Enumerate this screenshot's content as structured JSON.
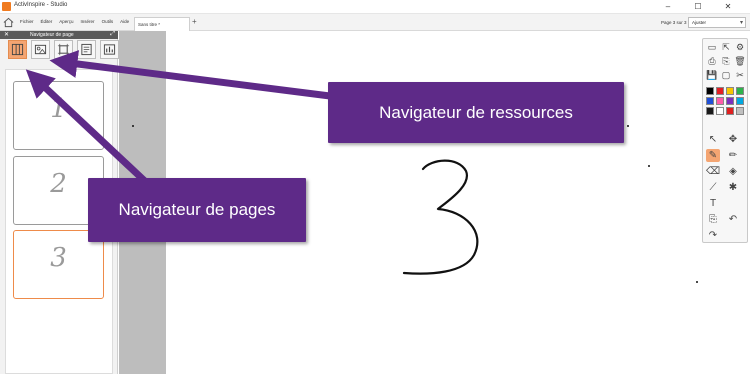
{
  "window": {
    "title": "ActivInspire - Studio",
    "minimize": "–",
    "maximize": "☐",
    "close": "✕"
  },
  "menubar": {
    "items": [
      "Fichier",
      "Éditer",
      "Aperçu",
      "Insérer",
      "Outils",
      "Aide"
    ],
    "document_tab": "Sans titre *",
    "add_tab": "+",
    "page_indicator": "Page 3 sur 3",
    "zoom_value": "Ajuster"
  },
  "left_panel": {
    "header_title": "Navigateur de page",
    "close": "✕",
    "expand": "⤢",
    "tabs": [
      "page-browser",
      "resource-browser",
      "object-browser",
      "notes-browser",
      "property-browser"
    ],
    "thumbnails": [
      {
        "label": "1",
        "active": false
      },
      {
        "label": "2",
        "active": false
      },
      {
        "label": "3",
        "active": true
      }
    ]
  },
  "canvas": {
    "drawn_text": "3"
  },
  "toolbox": {
    "top_tools": [
      "▭",
      "⇱",
      "⚙",
      "⎙",
      "⎘",
      "🗑",
      "💾",
      "▢",
      "✂"
    ],
    "swatches": [
      "#000000",
      "#e31e24",
      "#f7c600",
      "#2cb34a",
      "#1e4fd8",
      "#ff5ca8",
      "#7b2fbe",
      "#00a8e0",
      "#1a1a1a",
      "#ffffff",
      "#e02020",
      "#c0c0c0"
    ],
    "tools": [
      "↖",
      "✥",
      "✎",
      "✏",
      "⌫",
      "◈",
      "⟋",
      "✱",
      "T",
      "",
      "⎘",
      "↶",
      "↷",
      ""
    ]
  },
  "callouts": {
    "resources": "Navigateur de ressources",
    "pages": "Navigateur de pages"
  },
  "colors": {
    "callout_bg": "#5e2a88",
    "accent_orange": "#f4a572"
  }
}
